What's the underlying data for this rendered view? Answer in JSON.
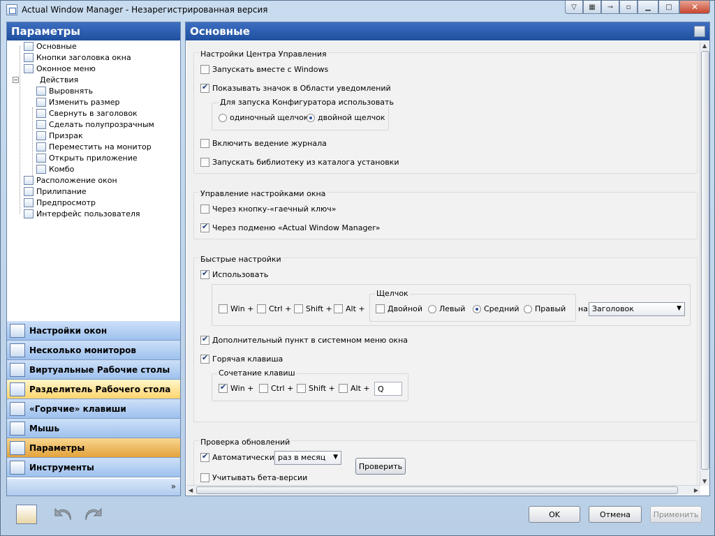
{
  "window": {
    "title": "Actual Window Manager - Незарегистрированная версия"
  },
  "left": {
    "header": "Параметры",
    "tree": [
      {
        "label": "Основные",
        "level": 1
      },
      {
        "label": "Кнопки заголовка окна",
        "level": 1
      },
      {
        "label": "Оконное меню",
        "level": 1
      },
      {
        "label": "Действия",
        "level": 1
      },
      {
        "label": "Выровнять",
        "level": 2
      },
      {
        "label": "Изменить размер",
        "level": 2
      },
      {
        "label": "Свернуть в заголовок",
        "level": 2
      },
      {
        "label": "Сделать полупрозрачным",
        "level": 2
      },
      {
        "label": "Призрак",
        "level": 2
      },
      {
        "label": "Переместить на монитор",
        "level": 2
      },
      {
        "label": "Открыть приложение",
        "level": 2
      },
      {
        "label": "Комбо",
        "level": 2
      },
      {
        "label": "Расположение окон",
        "level": 1
      },
      {
        "label": "Прилипание",
        "level": 1
      },
      {
        "label": "Предпросмотр",
        "level": 1
      },
      {
        "label": "Интерфейс пользователя",
        "level": 1
      }
    ],
    "nav": [
      {
        "label": "Настройки окон",
        "state": "normal"
      },
      {
        "label": "Несколько мониторов",
        "state": "normal"
      },
      {
        "label": "Виртуальные Рабочие столы",
        "state": "normal"
      },
      {
        "label": "Разделитель Рабочего стола",
        "state": "hover"
      },
      {
        "label": "«Горячие» клавиши",
        "state": "normal"
      },
      {
        "label": "Мышь",
        "state": "normal"
      },
      {
        "label": "Параметры",
        "state": "active"
      },
      {
        "label": "Инструменты",
        "state": "normal"
      }
    ]
  },
  "right": {
    "header": "Основные",
    "g1": {
      "title": "Настройки Центра Управления",
      "cb1": "Запускать вместе с Windows",
      "cb2": "Показывать значок в Области уведомлений",
      "sub_title": "Для запуска Конфигуратора использовать",
      "r1": "одиночный щелчок",
      "r2": "двойной щелчок",
      "cb3": "Включить ведение журнала",
      "cb4": "Запускать библиотеку из каталога установки"
    },
    "g2": {
      "title": "Управление настройками окна",
      "cb1": "Через кнопку-«гаечный ключ»",
      "cb2": "Через подменю «Actual Window Manager»"
    },
    "g3": {
      "title": "Быстрые настройки",
      "use": "Использовать",
      "win": "Win +",
      "ctrl": "Ctrl +",
      "shift": "Shift +",
      "alt": "Alt +",
      "click_title": "Щелчок",
      "double": "Двойной",
      "left": "Левый",
      "middle": "Средний",
      "right": "Правый",
      "on": "на",
      "target": "Заголовок",
      "sysmenu": "Дополнительный пункт в системном меню окна",
      "hotkey": "Горячая клавиша",
      "combo_title": "Сочетание клавиш",
      "key": "Q"
    },
    "g4": {
      "title": "Проверка обновлений",
      "auto": "Автоматически",
      "freq": "раз в месяц",
      "check": "Проверить",
      "beta": "Учитывать бета-версии"
    }
  },
  "buttons": {
    "ok": "OK",
    "cancel": "Отмена",
    "apply": "Применить"
  }
}
